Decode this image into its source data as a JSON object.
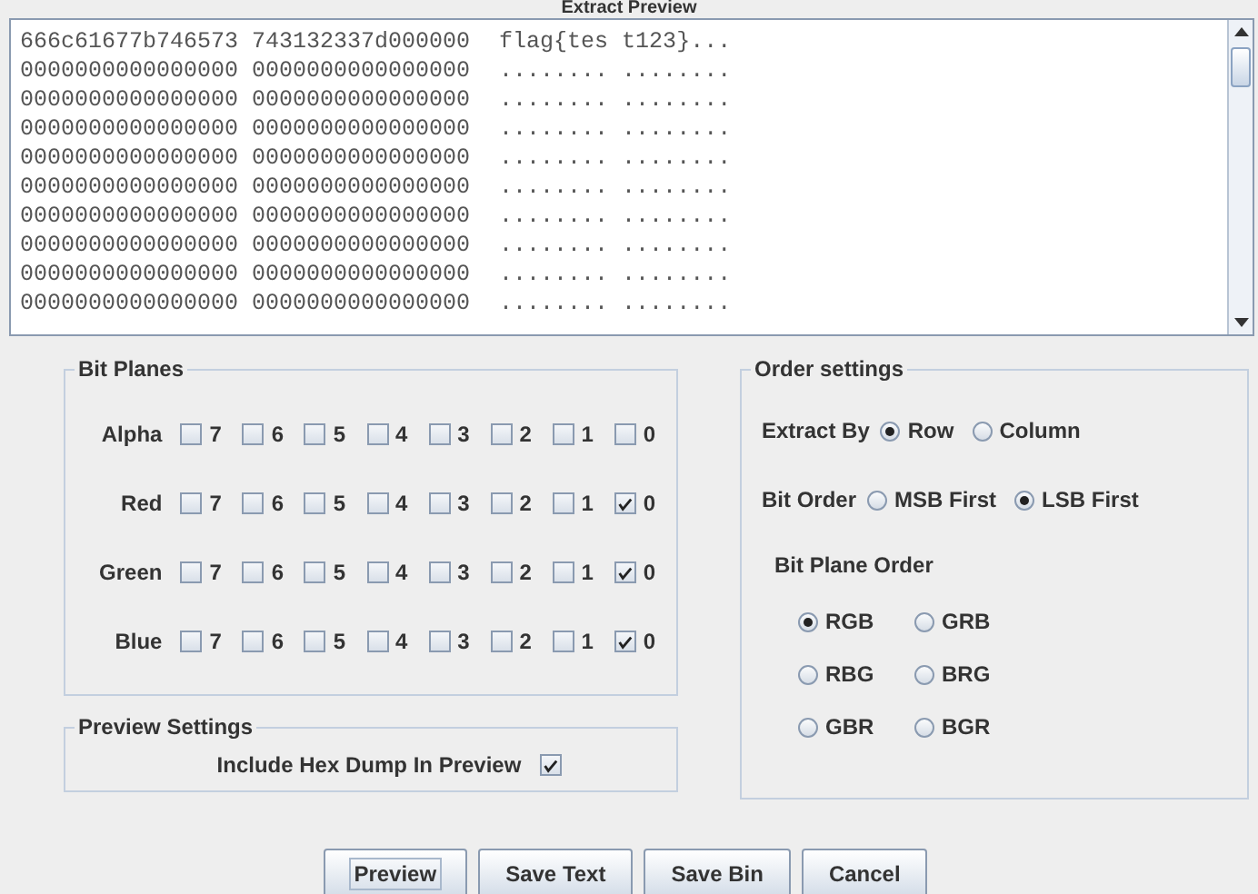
{
  "preview": {
    "title": "Extract Preview",
    "rows": [
      {
        "hex": "666c61677b746573 743132337d000000",
        "ascii": "flag{tes t123}..."
      },
      {
        "hex": "0000000000000000 0000000000000000",
        "ascii": "........ ........"
      },
      {
        "hex": "0000000000000000 0000000000000000",
        "ascii": "........ ........"
      },
      {
        "hex": "0000000000000000 0000000000000000",
        "ascii": "........ ........"
      },
      {
        "hex": "0000000000000000 0000000000000000",
        "ascii": "........ ........"
      },
      {
        "hex": "0000000000000000 0000000000000000",
        "ascii": "........ ........"
      },
      {
        "hex": "0000000000000000 0000000000000000",
        "ascii": "........ ........"
      },
      {
        "hex": "0000000000000000 0000000000000000",
        "ascii": "........ ........"
      },
      {
        "hex": "0000000000000000 0000000000000000",
        "ascii": "........ ........"
      },
      {
        "hex": "0000000000000000 0000000000000000",
        "ascii": "........ ........"
      }
    ]
  },
  "bit_planes": {
    "title": "Bit Planes",
    "channels": [
      {
        "name": "Alpha",
        "bits": [
          {
            "label": "7",
            "checked": false
          },
          {
            "label": "6",
            "checked": false
          },
          {
            "label": "5",
            "checked": false
          },
          {
            "label": "4",
            "checked": false
          },
          {
            "label": "3",
            "checked": false
          },
          {
            "label": "2",
            "checked": false
          },
          {
            "label": "1",
            "checked": false
          },
          {
            "label": "0",
            "checked": false
          }
        ]
      },
      {
        "name": "Red",
        "bits": [
          {
            "label": "7",
            "checked": false
          },
          {
            "label": "6",
            "checked": false
          },
          {
            "label": "5",
            "checked": false
          },
          {
            "label": "4",
            "checked": false
          },
          {
            "label": "3",
            "checked": false
          },
          {
            "label": "2",
            "checked": false
          },
          {
            "label": "1",
            "checked": false
          },
          {
            "label": "0",
            "checked": true
          }
        ]
      },
      {
        "name": "Green",
        "bits": [
          {
            "label": "7",
            "checked": false
          },
          {
            "label": "6",
            "checked": false
          },
          {
            "label": "5",
            "checked": false
          },
          {
            "label": "4",
            "checked": false
          },
          {
            "label": "3",
            "checked": false
          },
          {
            "label": "2",
            "checked": false
          },
          {
            "label": "1",
            "checked": false
          },
          {
            "label": "0",
            "checked": true
          }
        ]
      },
      {
        "name": "Blue",
        "bits": [
          {
            "label": "7",
            "checked": false
          },
          {
            "label": "6",
            "checked": false
          },
          {
            "label": "5",
            "checked": false
          },
          {
            "label": "4",
            "checked": false
          },
          {
            "label": "3",
            "checked": false
          },
          {
            "label": "2",
            "checked": false
          },
          {
            "label": "1",
            "checked": false
          },
          {
            "label": "0",
            "checked": true
          }
        ]
      }
    ]
  },
  "preview_settings": {
    "title": "Preview Settings",
    "option": {
      "label": "Include Hex Dump In Preview",
      "checked": true
    }
  },
  "order_settings": {
    "title": "Order settings",
    "extract_by": {
      "label": "Extract By",
      "options": [
        {
          "label": "Row",
          "selected": true
        },
        {
          "label": "Column",
          "selected": false
        }
      ]
    },
    "bit_order": {
      "label": "Bit Order",
      "options": [
        {
          "label": "MSB First",
          "selected": false
        },
        {
          "label": "LSB First",
          "selected": true
        }
      ]
    },
    "bit_plane_order": {
      "label": "Bit Plane Order",
      "options": [
        {
          "label": "RGB",
          "selected": true
        },
        {
          "label": "GRB",
          "selected": false
        },
        {
          "label": "RBG",
          "selected": false
        },
        {
          "label": "BRG",
          "selected": false
        },
        {
          "label": "GBR",
          "selected": false
        },
        {
          "label": "BGR",
          "selected": false
        }
      ]
    }
  },
  "buttons": [
    {
      "label": "Preview",
      "focused": true
    },
    {
      "label": "Save Text",
      "focused": false
    },
    {
      "label": "Save Bin",
      "focused": false
    },
    {
      "label": "Cancel",
      "focused": false
    }
  ]
}
